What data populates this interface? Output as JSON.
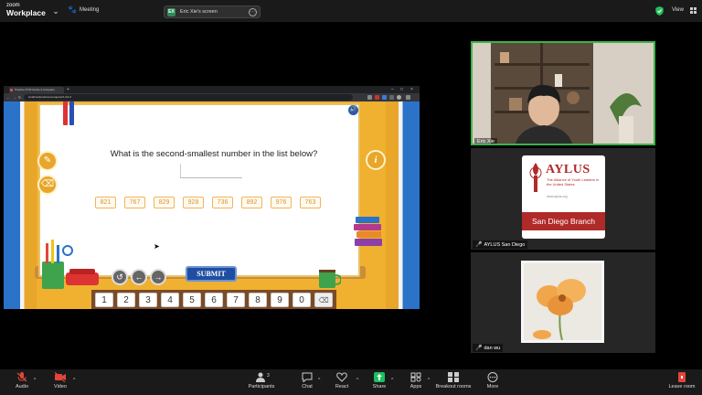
{
  "app": {
    "brand_top": "zoom",
    "brand_bottom": "Workplace"
  },
  "topbar": {
    "meeting_label": "Meeting",
    "screen_share": {
      "avatar": "EX",
      "label": "Eric Xie's screen"
    },
    "view_label": "View"
  },
  "browser": {
    "tab_title": "Practice PCM Grade 4 Unsquare",
    "url": "localhost/practice/unsquare/2-4/1-6"
  },
  "game": {
    "question": "What is the second-smallest number in the list below?",
    "numbers": [
      "821",
      "767",
      "829",
      "928",
      "736",
      "892",
      "976",
      "763"
    ],
    "submit_label": "SUBMIT",
    "keypad": [
      "1",
      "2",
      "3",
      "4",
      "5",
      "6",
      "7",
      "8",
      "9",
      "0"
    ],
    "info_glyph": "i",
    "icons": [
      "sound-icon",
      "pencil-icon",
      "eraser-icon",
      "undo-icon",
      "left-arrow-icon",
      "right-arrow-icon",
      "backspace-icon"
    ]
  },
  "participants": [
    {
      "name": "Eric Xie",
      "muted": false
    },
    {
      "name": "AYLUS San Diego",
      "muted": true
    },
    {
      "name": "dan wu",
      "muted": true
    }
  ],
  "aylus_card": {
    "title": "AYLUS",
    "subtitle": "The Alliance of Youth Leaders in the United States",
    "url": "www.aylus.org",
    "band": "San Diego Branch"
  },
  "toolbar": {
    "audio": "Audio",
    "video": "Video",
    "participants": "Participants",
    "participants_count": "3",
    "chat": "Chat",
    "react": "React",
    "share": "Share",
    "apps": "Apps",
    "breakout": "Breakout rooms",
    "more": "More",
    "leave": "Leave room"
  },
  "colors": {
    "active_speaker": "#3db34a",
    "share_green": "#1dbf5f",
    "muted_red": "#e0463a",
    "aylus_red": "#b02a2a"
  }
}
